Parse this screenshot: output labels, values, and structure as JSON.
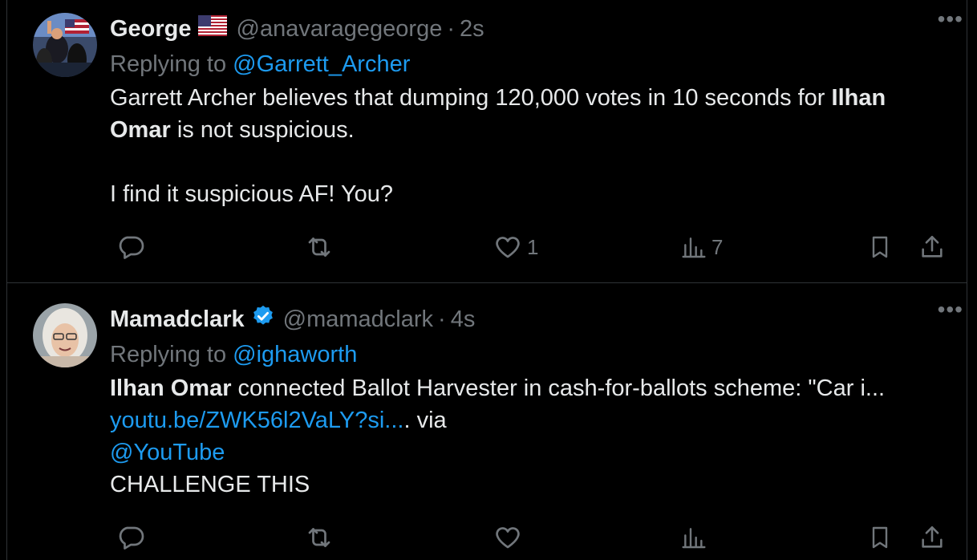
{
  "colors": {
    "background": "#000000",
    "text": "#e7e9ea",
    "muted": "#71767b",
    "link": "#1d9bf0",
    "border": "#2f3336"
  },
  "tweets": [
    {
      "name": "George",
      "name_badge": "us-flag-emoji",
      "handle": "@anavaragegeorge",
      "time": "2s",
      "reply_prefix": "Replying to",
      "reply_to": "@Garrett_Archer",
      "body": {
        "line1_a": "Garrett Archer believes that dumping 120,000 votes in 10 seconds for ",
        "line1_bold": "Ilhan",
        "line2_bold": "Omar",
        "line2_b": " is not suspicious.",
        "line3": "I find it suspicious AF! You?"
      },
      "more_icon": "more-horizontal-icon",
      "actions": {
        "reply_count": "",
        "retweet_count": "",
        "like_count": "1",
        "views_count": "7"
      }
    },
    {
      "name": "Mamadclark",
      "name_badge": "verified-badge",
      "handle": "@mamadclark",
      "time": "4s",
      "reply_prefix": "Replying to",
      "reply_to": "@ighaworth",
      "body": {
        "line1_bold": "Ilhan Omar",
        "line1_b": " connected Ballot Harvester in cash-for-ballots scheme: \"Car i...",
        "link": "youtu.be/ZWK56l2VaLY?si...",
        "after_link": ". via",
        "mention": "@YouTube",
        "line4": "CHALLENGE THIS"
      },
      "more_icon": "more-horizontal-icon",
      "actions": {
        "reply_count": "",
        "retweet_count": "",
        "like_count": "",
        "views_count": ""
      }
    }
  ]
}
